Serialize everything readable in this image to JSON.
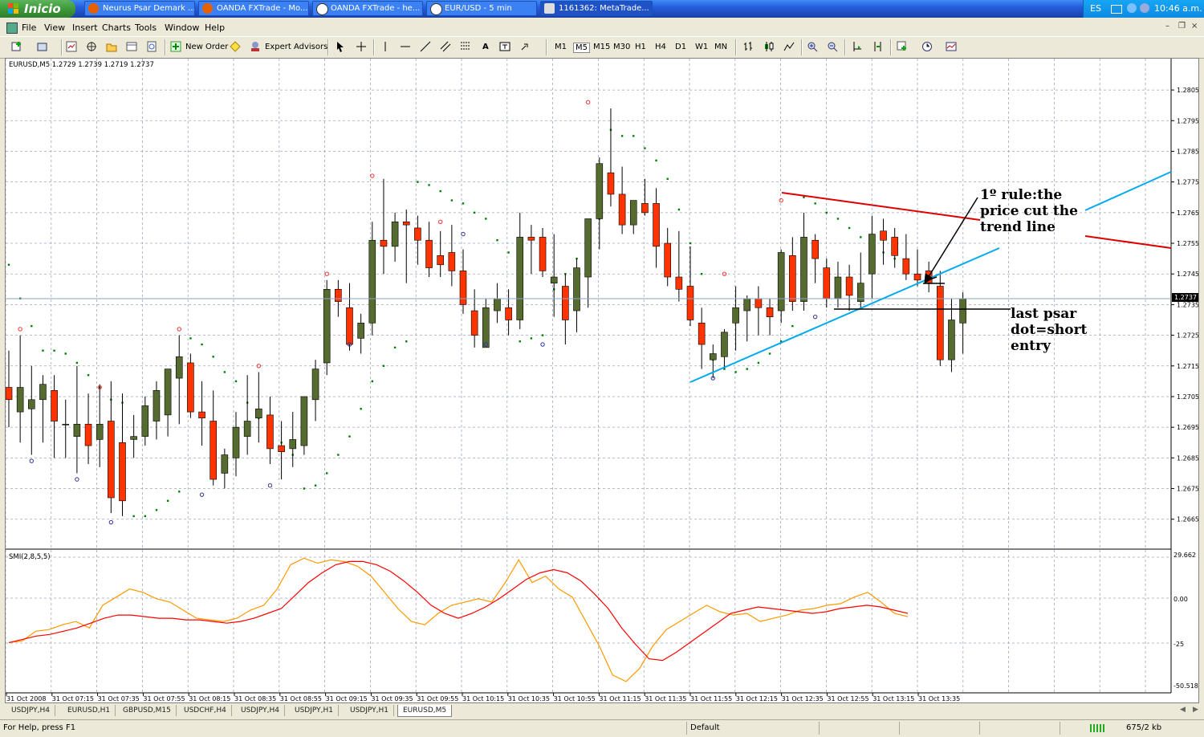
{
  "taskbar": {
    "start_label": "Inicio",
    "buttons": [
      {
        "label": "Neurus Psar Demark ..."
      },
      {
        "label": "OANDA FXTrade - Mo..."
      },
      {
        "label": "OANDA FXTrade - he..."
      },
      {
        "label": "EUR/USD - 5 min"
      },
      {
        "label": "1161362: MetaTrade..."
      }
    ],
    "lang": "ES",
    "clock": "10:46 a.m."
  },
  "menubar": {
    "items": [
      "File",
      "View",
      "Insert",
      "Charts",
      "Tools",
      "Window",
      "Help"
    ]
  },
  "toolbar": {
    "new_order": "New Order",
    "expert_advisors": "Expert Advisors",
    "timeframes": [
      "M1",
      "M5",
      "M15",
      "M30",
      "H1",
      "H4",
      "D1",
      "W1",
      "MN"
    ],
    "active_timeframe": "M5"
  },
  "chart": {
    "symbol_header": "EURUSD,M5  1.2729 1.2739 1.2719 1.2737",
    "price_labels": [
      "1.2805",
      "1.2795",
      "1.2785",
      "1.2775",
      "1.2765",
      "1.2755",
      "1.2745",
      "1.2735",
      "1.2725",
      "1.2715",
      "1.2705",
      "1.2695",
      "1.2685",
      "1.2675",
      "1.2665"
    ],
    "current_price": "1.2737",
    "indicator_label": "SMI(2,8,5,5)",
    "indicator_scale": [
      "29.662",
      "0.00",
      "-25",
      "-50.5181"
    ],
    "time_labels": [
      "31 Oct 2008",
      "31 Oct 07:15",
      "31 Oct 07:35",
      "31 Oct 07:55",
      "31 Oct 08:15",
      "31 Oct 08:35",
      "31 Oct 08:55",
      "31 Oct 09:15",
      "31 Oct 09:35",
      "31 Oct 09:55",
      "31 Oct 10:15",
      "31 Oct 10:35",
      "31 Oct 10:55",
      "31 Oct 11:15",
      "31 Oct 11:35",
      "31 Oct 11:55",
      "31 Oct 12:15",
      "31 Oct 12:35",
      "31 Oct 12:55",
      "31 Oct 13:15",
      "31 Oct 13:35"
    ],
    "annotation_rule": [
      "1º rule:the",
      "price cut the",
      "trend line"
    ],
    "annotation_entry": [
      "last psar",
      "dot=short",
      "entry"
    ],
    "colors": {
      "bull": "#556b2f",
      "bear": "#ff3300",
      "psar": "#008000",
      "smi_main": "#ff0000",
      "smi_signal": "#ff9900",
      "trendline": "#00aaee",
      "resistance": "#dd0000"
    }
  },
  "chart_data": {
    "type": "candlestick",
    "symbol": "EURUSD",
    "timeframe": "M5",
    "ohlc_header": {
      "open": 1.2729,
      "high": 1.2739,
      "low": 1.2719,
      "close": 1.2737
    },
    "ylim": [
      1.2661,
      1.281
    ],
    "candles": [
      {
        "o": 1.2708,
        "h": 1.272,
        "l": 1.2695,
        "c": 1.2704
      },
      {
        "o": 1.27,
        "h": 1.2725,
        "l": 1.269,
        "c": 1.2708
      },
      {
        "o": 1.2701,
        "h": 1.2715,
        "l": 1.2686,
        "c": 1.2704
      },
      {
        "o": 1.2704,
        "h": 1.2712,
        "l": 1.269,
        "c": 1.2709
      },
      {
        "o": 1.2707,
        "h": 1.2712,
        "l": 1.2685,
        "c": 1.2697
      },
      {
        "o": 1.2696,
        "h": 1.2704,
        "l": 1.2685,
        "c": 1.2696
      },
      {
        "o": 1.2692,
        "h": 1.2715,
        "l": 1.268,
        "c": 1.2696
      },
      {
        "o": 1.2696,
        "h": 1.2706,
        "l": 1.2683,
        "c": 1.2689
      },
      {
        "o": 1.2691,
        "h": 1.2709,
        "l": 1.2682,
        "c": 1.2696
      },
      {
        "o": 1.2697,
        "h": 1.271,
        "l": 1.2667,
        "c": 1.2672
      },
      {
        "o": 1.269,
        "h": 1.2706,
        "l": 1.2666,
        "c": 1.2671
      },
      {
        "o": 1.2691,
        "h": 1.2699,
        "l": 1.2685,
        "c": 1.2692
      },
      {
        "o": 1.2692,
        "h": 1.2705,
        "l": 1.2689,
        "c": 1.2702
      },
      {
        "o": 1.2697,
        "h": 1.271,
        "l": 1.2691,
        "c": 1.2707
      },
      {
        "o": 1.2699,
        "h": 1.2712,
        "l": 1.2692,
        "c": 1.2714
      },
      {
        "o": 1.2711,
        "h": 1.2725,
        "l": 1.2696,
        "c": 1.2718
      },
      {
        "o": 1.2716,
        "h": 1.2719,
        "l": 1.2698,
        "c": 1.27
      },
      {
        "o": 1.27,
        "h": 1.271,
        "l": 1.2689,
        "c": 1.2698
      },
      {
        "o": 1.2697,
        "h": 1.2707,
        "l": 1.2676,
        "c": 1.2678
      },
      {
        "o": 1.268,
        "h": 1.2688,
        "l": 1.2675,
        "c": 1.2686
      },
      {
        "o": 1.2685,
        "h": 1.27,
        "l": 1.2679,
        "c": 1.2695
      },
      {
        "o": 1.2692,
        "h": 1.2712,
        "l": 1.2686,
        "c": 1.2697
      },
      {
        "o": 1.2698,
        "h": 1.2713,
        "l": 1.269,
        "c": 1.2701
      },
      {
        "o": 1.2699,
        "h": 1.2705,
        "l": 1.2683,
        "c": 1.2688
      },
      {
        "o": 1.2689,
        "h": 1.2697,
        "l": 1.2678,
        "c": 1.2687
      },
      {
        "o": 1.2688,
        "h": 1.27,
        "l": 1.2682,
        "c": 1.2691
      },
      {
        "o": 1.2689,
        "h": 1.2702,
        "l": 1.2686,
        "c": 1.2705
      },
      {
        "o": 1.2704,
        "h": 1.2717,
        "l": 1.2697,
        "c": 1.2714
      },
      {
        "o": 1.2716,
        "h": 1.2743,
        "l": 1.2712,
        "c": 1.274
      },
      {
        "o": 1.274,
        "h": 1.2743,
        "l": 1.2731,
        "c": 1.2736
      },
      {
        "o": 1.2734,
        "h": 1.2742,
        "l": 1.272,
        "c": 1.2722
      },
      {
        "o": 1.2724,
        "h": 1.2732,
        "l": 1.2719,
        "c": 1.2729
      },
      {
        "o": 1.2729,
        "h": 1.2762,
        "l": 1.2725,
        "c": 1.2756
      },
      {
        "o": 1.2756,
        "h": 1.2776,
        "l": 1.2745,
        "c": 1.2754
      },
      {
        "o": 1.2754,
        "h": 1.2765,
        "l": 1.2749,
        "c": 1.2762
      },
      {
        "o": 1.2762,
        "h": 1.2766,
        "l": 1.2742,
        "c": 1.2761
      },
      {
        "o": 1.276,
        "h": 1.2764,
        "l": 1.2748,
        "c": 1.2756
      },
      {
        "o": 1.2756,
        "h": 1.2762,
        "l": 1.2744,
        "c": 1.2747
      },
      {
        "o": 1.2751,
        "h": 1.2759,
        "l": 1.2744,
        "c": 1.2748
      },
      {
        "o": 1.2752,
        "h": 1.2761,
        "l": 1.2741,
        "c": 1.2746
      },
      {
        "o": 1.2746,
        "h": 1.2753,
        "l": 1.2732,
        "c": 1.2735
      },
      {
        "o": 1.2733,
        "h": 1.274,
        "l": 1.2721,
        "c": 1.2725
      },
      {
        "o": 1.2721,
        "h": 1.2737,
        "l": 1.2721,
        "c": 1.2734
      },
      {
        "o": 1.2733,
        "h": 1.2742,
        "l": 1.2729,
        "c": 1.2737
      },
      {
        "o": 1.2734,
        "h": 1.274,
        "l": 1.2725,
        "c": 1.273
      },
      {
        "o": 1.273,
        "h": 1.2765,
        "l": 1.2727,
        "c": 1.2757
      },
      {
        "o": 1.2757,
        "h": 1.2761,
        "l": 1.2745,
        "c": 1.2756
      },
      {
        "o": 1.2757,
        "h": 1.276,
        "l": 1.2744,
        "c": 1.2746
      },
      {
        "o": 1.2742,
        "h": 1.2758,
        "l": 1.2731,
        "c": 1.2744
      },
      {
        "o": 1.2741,
        "h": 1.2745,
        "l": 1.2722,
        "c": 1.273
      },
      {
        "o": 1.2733,
        "h": 1.275,
        "l": 1.2726,
        "c": 1.2747
      },
      {
        "o": 1.2744,
        "h": 1.2758,
        "l": 1.2734,
        "c": 1.2763
      },
      {
        "o": 1.2763,
        "h": 1.2783,
        "l": 1.2753,
        "c": 1.2781
      },
      {
        "o": 1.2778,
        "h": 1.2799,
        "l": 1.2767,
        "c": 1.2771
      },
      {
        "o": 1.2771,
        "h": 1.278,
        "l": 1.2758,
        "c": 1.2761
      },
      {
        "o": 1.2761,
        "h": 1.2767,
        "l": 1.2758,
        "c": 1.2769
      },
      {
        "o": 1.2768,
        "h": 1.2776,
        "l": 1.2764,
        "c": 1.2765
      },
      {
        "o": 1.2768,
        "h": 1.2773,
        "l": 1.2747,
        "c": 1.2754
      },
      {
        "o": 1.2755,
        "h": 1.276,
        "l": 1.2741,
        "c": 1.2744
      },
      {
        "o": 1.2744,
        "h": 1.2759,
        "l": 1.2736,
        "c": 1.274
      },
      {
        "o": 1.2741,
        "h": 1.2754,
        "l": 1.2728,
        "c": 1.273
      },
      {
        "o": 1.2729,
        "h": 1.2734,
        "l": 1.2714,
        "c": 1.2722
      },
      {
        "o": 1.2717,
        "h": 1.2722,
        "l": 1.2711,
        "c": 1.2719
      },
      {
        "o": 1.2718,
        "h": 1.2727,
        "l": 1.2714,
        "c": 1.2726
      },
      {
        "o": 1.2729,
        "h": 1.2741,
        "l": 1.272,
        "c": 1.2734
      },
      {
        "o": 1.2733,
        "h": 1.2738,
        "l": 1.2723,
        "c": 1.2737
      },
      {
        "o": 1.2737,
        "h": 1.2741,
        "l": 1.2725,
        "c": 1.2734
      },
      {
        "o": 1.2734,
        "h": 1.2737,
        "l": 1.2725,
        "c": 1.2731
      },
      {
        "o": 1.2733,
        "h": 1.2753,
        "l": 1.2729,
        "c": 1.2752
      },
      {
        "o": 1.2751,
        "h": 1.2757,
        "l": 1.2733,
        "c": 1.2736
      },
      {
        "o": 1.2736,
        "h": 1.2765,
        "l": 1.2733,
        "c": 1.2757
      },
      {
        "o": 1.2756,
        "h": 1.2758,
        "l": 1.2742,
        "c": 1.275
      },
      {
        "o": 1.2747,
        "h": 1.275,
        "l": 1.2734,
        "c": 1.2737
      },
      {
        "o": 1.2737,
        "h": 1.2749,
        "l": 1.2734,
        "c": 1.2744
      },
      {
        "o": 1.2744,
        "h": 1.2748,
        "l": 1.2733,
        "c": 1.2738
      },
      {
        "o": 1.2736,
        "h": 1.2752,
        "l": 1.2734,
        "c": 1.2742
      },
      {
        "o": 1.2745,
        "h": 1.2764,
        "l": 1.2737,
        "c": 1.2758
      },
      {
        "o": 1.2759,
        "h": 1.2763,
        "l": 1.2748,
        "c": 1.2756
      },
      {
        "o": 1.2757,
        "h": 1.276,
        "l": 1.2747,
        "c": 1.2751
      },
      {
        "o": 1.275,
        "h": 1.2758,
        "l": 1.2743,
        "c": 1.2745
      },
      {
        "o": 1.2745,
        "h": 1.2753,
        "l": 1.2741,
        "c": 1.2743
      },
      {
        "o": 1.2746,
        "h": 1.2749,
        "l": 1.2739,
        "c": 1.2742
      },
      {
        "o": 1.2741,
        "h": 1.2746,
        "l": 1.2715,
        "c": 1.2717
      },
      {
        "o": 1.2717,
        "h": 1.2737,
        "l": 1.2713,
        "c": 1.273
      },
      {
        "o": 1.2729,
        "h": 1.2739,
        "l": 1.2719,
        "c": 1.2737
      }
    ],
    "psar_dots": [
      {
        "i": 0,
        "v": 1.2748
      },
      {
        "i": 1,
        "v": 1.2737
      },
      {
        "i": 2,
        "v": 1.2728
      },
      {
        "i": 3,
        "v": 1.272
      },
      {
        "i": 4,
        "v": 1.272
      },
      {
        "i": 5,
        "v": 1.2719
      },
      {
        "i": 6,
        "v": 1.2716
      },
      {
        "i": 7,
        "v": 1.2712
      },
      {
        "i": 8,
        "v": 1.2708
      },
      {
        "i": 9,
        "v": 1.2704
      },
      {
        "i": 10,
        "v": 1.2703
      },
      {
        "i": 11,
        "v": 1.2666
      },
      {
        "i": 12,
        "v": 1.2666
      },
      {
        "i": 13,
        "v": 1.2668
      },
      {
        "i": 14,
        "v": 1.2671
      },
      {
        "i": 15,
        "v": 1.2674
      },
      {
        "i": 16,
        "v": 1.2724
      },
      {
        "i": 17,
        "v": 1.2722
      },
      {
        "i": 18,
        "v": 1.2718
      },
      {
        "i": 19,
        "v": 1.2713
      },
      {
        "i": 20,
        "v": 1.271
      },
      {
        "i": 21,
        "v": 1.2703
      },
      {
        "i": 22,
        "v": 1.2698
      },
      {
        "i": 23,
        "v": 1.2693
      },
      {
        "i": 24,
        "v": 1.269
      },
      {
        "i": 25,
        "v": 1.2686
      },
      {
        "i": 26,
        "v": 1.2675
      },
      {
        "i": 27,
        "v": 1.2676
      },
      {
        "i": 28,
        "v": 1.268
      },
      {
        "i": 29,
        "v": 1.2686
      },
      {
        "i": 30,
        "v": 1.2692
      },
      {
        "i": 31,
        "v": 1.2701
      },
      {
        "i": 32,
        "v": 1.271
      },
      {
        "i": 33,
        "v": 1.2715
      },
      {
        "i": 34,
        "v": 1.2721
      },
      {
        "i": 35,
        "v": 1.2723
      },
      {
        "i": 36,
        "v": 1.2775
      },
      {
        "i": 37,
        "v": 1.2774
      },
      {
        "i": 38,
        "v": 1.2772
      },
      {
        "i": 39,
        "v": 1.2769
      },
      {
        "i": 40,
        "v": 1.2768
      },
      {
        "i": 41,
        "v": 1.2765
      },
      {
        "i": 42,
        "v": 1.2763
      },
      {
        "i": 43,
        "v": 1.2756
      },
      {
        "i": 44,
        "v": 1.2752
      },
      {
        "i": 45,
        "v": 1.2723
      },
      {
        "i": 46,
        "v": 1.2724
      },
      {
        "i": 47,
        "v": 1.2725
      },
      {
        "i": 48,
        "v": 1.274
      },
      {
        "i": 49,
        "v": 1.2745
      },
      {
        "i": 50,
        "v": 1.275
      },
      {
        "i": 51,
        "v": 1.276
      },
      {
        "i": 52,
        "v": 1.2763
      },
      {
        "i": 53,
        "v": 1.2792
      },
      {
        "i": 54,
        "v": 1.279
      },
      {
        "i": 55,
        "v": 1.279
      },
      {
        "i": 56,
        "v": 1.2786
      },
      {
        "i": 57,
        "v": 1.2782
      },
      {
        "i": 58,
        "v": 1.2776
      },
      {
        "i": 59,
        "v": 1.2766
      },
      {
        "i": 60,
        "v": 1.2755
      },
      {
        "i": 61,
        "v": 1.2745
      },
      {
        "i": 62,
        "v": 1.2717
      },
      {
        "i": 63,
        "v": 1.2714
      },
      {
        "i": 64,
        "v": 1.2713
      },
      {
        "i": 65,
        "v": 1.2714
      },
      {
        "i": 66,
        "v": 1.2716
      },
      {
        "i": 67,
        "v": 1.2719
      },
      {
        "i": 68,
        "v": 1.2723
      },
      {
        "i": 69,
        "v": 1.2728
      },
      {
        "i": 70,
        "v": 1.277
      },
      {
        "i": 71,
        "v": 1.2768
      },
      {
        "i": 72,
        "v": 1.2765
      },
      {
        "i": 73,
        "v": 1.2763
      },
      {
        "i": 74,
        "v": 1.276
      },
      {
        "i": 75,
        "v": 1.2757
      },
      {
        "i": 76,
        "v": 1.2755
      },
      {
        "i": 77,
        "v": 1.2752
      },
      {
        "i": 78,
        "v": 1.275
      },
      {
        "i": 79,
        "v": 1.2748
      }
    ],
    "smi": {
      "main": [
        -23,
        -21,
        -19,
        -18,
        -16,
        -14,
        -11,
        -8,
        -6,
        -6,
        -7,
        -8,
        -8,
        -9,
        -9,
        -10,
        -11,
        -10,
        -8,
        -5,
        -2,
        6,
        14,
        20,
        25,
        27,
        27,
        25,
        21,
        15,
        8,
        0,
        -5,
        -8,
        -5,
        -1,
        4,
        10,
        16,
        20,
        22,
        20,
        15,
        7,
        -2,
        -14,
        -24,
        -33,
        -34,
        -29,
        -23,
        -17,
        -11,
        -5,
        -3,
        -1,
        -2,
        -3,
        -4,
        -5,
        -4,
        -2,
        -1,
        0,
        -1,
        -3,
        -5
      ],
      "signal": [
        -23,
        -22,
        -16,
        -15,
        -12,
        -10,
        -14,
        0,
        5,
        10,
        8,
        4,
        2,
        -3,
        -8,
        -9,
        -10,
        -8,
        -3,
        0,
        10,
        25,
        29,
        26,
        28,
        27,
        24,
        18,
        8,
        -2,
        -10,
        -12,
        -5,
        0,
        2,
        4,
        2,
        14,
        28,
        14,
        18,
        10,
        5,
        -10,
        -25,
        -43,
        -47,
        -39,
        -25,
        -15,
        -10,
        -5,
        0,
        -4,
        -6,
        -5,
        -10,
        -8,
        -6,
        -3,
        -2,
        0,
        1,
        5,
        8,
        2,
        -5,
        -7
      ]
    }
  },
  "bottom_tabs": [
    "USDJPY,H4",
    "EURUSD,H1",
    "GBPUSD,M15",
    "USDCHF,H4",
    "USDJPY,H4",
    "USDJPY,H1",
    "USDJPY,H1",
    "EURUSD,M5"
  ],
  "active_tab": "EURUSD,M5",
  "status": {
    "help": "For Help, press F1",
    "profile": "Default",
    "traffic": "675/2 kb"
  }
}
